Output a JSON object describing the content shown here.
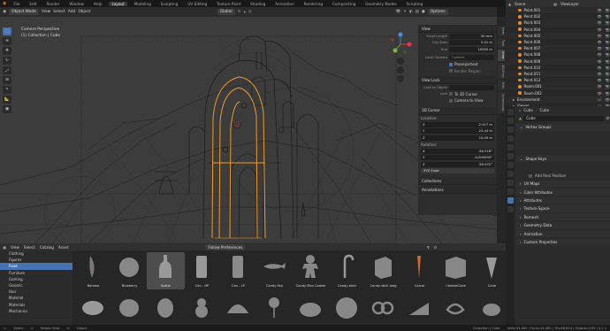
{
  "menu": [
    "File",
    "Edit",
    "Render",
    "Window",
    "Help"
  ],
  "workspaces": [
    "Layout",
    "Modeling",
    "Sculpting",
    "UV Editing",
    "Texture Paint",
    "Shading",
    "Animation",
    "Rendering",
    "Compositing",
    "Geometry Nodes",
    "Scripting"
  ],
  "viewport": {
    "mode": "Object Mode",
    "menus": [
      "View",
      "Select",
      "Add",
      "Object"
    ],
    "orientation": "Global",
    "options": "Options",
    "camera_label": "Camera Perspective",
    "collection_label": "(1) Collection | Cube"
  },
  "npanel": {
    "view_title": "View",
    "focal_label": "Focal Length",
    "focal_value": "50 mm",
    "clip_start_label": "Clip Start",
    "clip_start_value": "0.01 m",
    "end_label": "End",
    "end_value": "10000 m",
    "local_camera_label": "Local Camera",
    "local_camera_value": "Camera",
    "passepartout": "Passepartout",
    "render_region": "Render Region",
    "view_lock_title": "View Lock",
    "lock_to_object_label": "Lock to Object",
    "lock_label": "Lock",
    "to_3d_cursor": "To 3D Cursor",
    "camera_to_view": "Camera to View",
    "cursor_title": "3D Cursor",
    "location_label": "Location:",
    "loc": [
      {
        "axis": "X",
        "value": "-2.517 m"
      },
      {
        "axis": "Y",
        "value": "24.44 m"
      },
      {
        "axis": "Z",
        "value": "10.09 m"
      }
    ],
    "rotation_label": "Rotation:",
    "rot": [
      {
        "axis": "X",
        "value": "80.518°"
      },
      {
        "axis": "Y",
        "value": "-0.000000°"
      },
      {
        "axis": "Z",
        "value": "69.972°"
      }
    ],
    "rot_mode": "XYZ Euler",
    "collections": "Collections",
    "annotations": "Annotations"
  },
  "side_tabs": [
    "Item",
    "Tool",
    "View",
    "3D-Print",
    "Edit",
    "Screencast"
  ],
  "outliner": {
    "scene": "Scene",
    "view_layer": "ViewLayer",
    "items": [
      "Point.001",
      "Point.002",
      "Point.003",
      "Point.004",
      "Point.005",
      "Point.006",
      "Point.007",
      "Point.008",
      "Point.009",
      "Point.010",
      "Point.011",
      "Point.012",
      "Room.001",
      "Room.002"
    ],
    "environment": "Environment",
    "viewer": "Viewer"
  },
  "properties": {
    "object": "Cube",
    "data": "Cube",
    "data_name": "Cube",
    "panels": [
      "Vertex Groups",
      "Shape Keys",
      "UV Maps",
      "Color Attributes",
      "Attributes",
      "Texture Space",
      "Remesh",
      "Geometry Data",
      "Animation",
      "Custom Properties"
    ],
    "add_rest": "Add Rest Position"
  },
  "library": {
    "menus": [
      "View",
      "Select",
      "Catalog",
      "Asset"
    ],
    "title": "Follow Preferences",
    "categories": [
      "Clothing",
      "Figures",
      "Food",
      "Furniture",
      "Gaming",
      "Generic",
      "Hair",
      "Material",
      "Materials",
      "Mechanics"
    ],
    "active_category": "Food",
    "assets": [
      "Banana",
      "Blueberry",
      "Bottle",
      "Can - HP",
      "Can - LP",
      "Candy fish",
      "Candy Man Cookie",
      "Candy stick",
      "Candy stick long",
      "Carrot",
      "CheeseCube",
      "Cone"
    ]
  },
  "status": {
    "left": "Select",
    "mid": "Rotate View",
    "right1": "Object",
    "collection": "Collection | Cube",
    "stats": "Verts:33,463 | Faces:34,485 | Tris:66,814 | Objects:1/59 | 4.1.1"
  },
  "colors": {
    "accent": "#4772b3",
    "select_orange": "#f09a2a",
    "viewport": "#3c3c3c"
  }
}
